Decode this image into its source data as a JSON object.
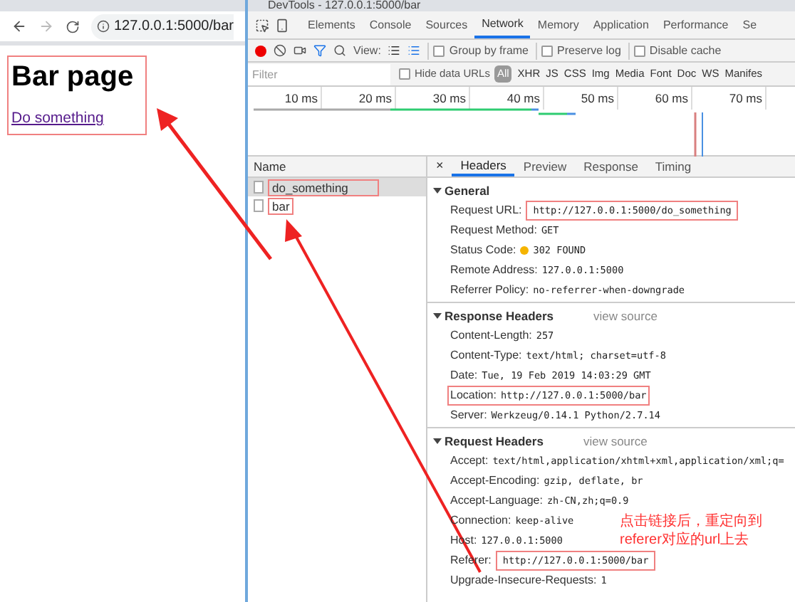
{
  "browser": {
    "url": "127.0.0.1:5000/bar",
    "heading": "Bar page",
    "link": "Do something",
    "boxed": true
  },
  "devtools": {
    "title": "DevTools - 127.0.0.1:5000/bar",
    "tabs": [
      {
        "label": "Elements",
        "selected": false
      },
      {
        "label": "Console",
        "selected": false
      },
      {
        "label": "Sources",
        "selected": false
      },
      {
        "label": "Network",
        "selected": true
      },
      {
        "label": "Memory",
        "selected": false
      },
      {
        "label": "Application",
        "selected": false
      },
      {
        "label": "Performance",
        "selected": false
      },
      {
        "label": "Se",
        "selected": false
      }
    ],
    "view_label": "View:",
    "options": [
      {
        "label": "Group by frame",
        "checked": false
      },
      {
        "label": "Preserve log",
        "checked": false
      },
      {
        "label": "Disable cache",
        "checked": false
      }
    ],
    "filter": {
      "placeholder": "Filter",
      "hide_data_urls": {
        "label": "Hide data URLs",
        "checked": false
      }
    },
    "types": [
      {
        "label": "All",
        "selected": true
      },
      {
        "label": "XHR",
        "selected": false
      },
      {
        "label": "JS",
        "selected": false
      },
      {
        "label": "CSS",
        "selected": false
      },
      {
        "label": "Img",
        "selected": false
      },
      {
        "label": "Media",
        "selected": false
      },
      {
        "label": "Font",
        "selected": false
      },
      {
        "label": "Doc",
        "selected": false
      },
      {
        "label": "WS",
        "selected": false
      },
      {
        "label": "Manifes",
        "selected": false
      }
    ],
    "ticks": [
      "10 ms",
      "20 ms",
      "30 ms",
      "40 ms",
      "50 ms",
      "60 ms",
      "70 ms"
    ],
    "name_column": "Name",
    "requests": [
      {
        "name": "do_something",
        "selected": true,
        "boxed": true
      },
      {
        "name": "bar",
        "selected": false,
        "boxed": true
      }
    ],
    "close": "×",
    "detail_tabs": [
      {
        "label": "Headers",
        "selected": true
      },
      {
        "label": "Preview",
        "selected": false
      },
      {
        "label": "Response",
        "selected": false
      },
      {
        "label": "Timing",
        "selected": false
      }
    ],
    "sections": [
      {
        "title": "General",
        "expanded": true,
        "rows": [
          {
            "key": "Request URL:",
            "value": "http://127.0.0.1:5000/do_something",
            "boxed": true,
            "key_boxed": false
          },
          {
            "key": "Request Method:",
            "value": "GET",
            "boxed": false
          },
          {
            "key": "Status Code:",
            "value": "302 FOUND",
            "boxed": false,
            "color": "#f5b400"
          },
          {
            "key": "Remote Address:",
            "value": "127.0.0.1:5000",
            "boxed": false
          },
          {
            "key": "Referrer Policy:",
            "value": "no-referrer-when-downgrade",
            "boxed": false
          }
        ]
      },
      {
        "title": "Response Headers",
        "expanded": true,
        "view_source": "view source",
        "rows": [
          {
            "key": "Content-Length:",
            "value": "257",
            "boxed": false
          },
          {
            "key": "Content-Type:",
            "value": "text/html; charset=utf-8",
            "boxed": false
          },
          {
            "key": "Date:",
            "value": "Tue, 19 Feb 2019 14:03:29 GMT",
            "boxed": false
          },
          {
            "key": "Location:",
            "value": "http://127.0.0.1:5000/bar",
            "boxed": true,
            "key_boxed": true
          },
          {
            "key": "Server:",
            "value": "Werkzeug/0.14.1 Python/2.7.14",
            "boxed": false
          }
        ]
      },
      {
        "title": "Request Headers",
        "expanded": true,
        "view_source": "view source",
        "rows": [
          {
            "key": "Accept:",
            "value": "text/html,application/xhtml+xml,application/xml;q=",
            "boxed": false
          },
          {
            "key": "Accept-Encoding:",
            "value": "gzip, deflate, br",
            "boxed": false
          },
          {
            "key": "Accept-Language:",
            "value": "zh-CN,zh;q=0.9",
            "boxed": false
          },
          {
            "key": "Connection:",
            "value": "keep-alive",
            "boxed": false
          },
          {
            "key": "Host:",
            "value": "127.0.0.1:5000",
            "boxed": false
          },
          {
            "key": "Referer:",
            "value": "http://127.0.0.1:5000/bar",
            "boxed": true,
            "key_boxed": false
          },
          {
            "key": "Upgrade-Insecure-Requests:",
            "value": "1",
            "boxed": false
          }
        ]
      }
    ]
  },
  "annotation": [
    "点击链接后，重定向到",
    "referer对应的url上去"
  ]
}
